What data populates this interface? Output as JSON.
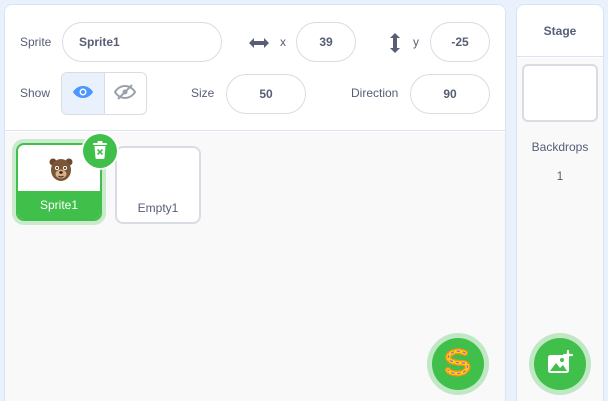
{
  "sprite_info": {
    "sprite_label": "Sprite",
    "sprite_name": "Sprite1",
    "x_label": "x",
    "x_value": "39",
    "y_label": "y",
    "y_value": "-25",
    "show_label": "Show",
    "show_visible": true,
    "size_label": "Size",
    "size_value": "50",
    "direction_label": "Direction",
    "direction_value": "90"
  },
  "sprites": [
    {
      "name": "Sprite1",
      "selected": true,
      "thumbnail": "bear-costume"
    },
    {
      "name": "Empty1",
      "selected": false,
      "thumbnail": "empty"
    }
  ],
  "stage": {
    "title": "Stage",
    "backdrops_label": "Backdrops",
    "backdrops_count": "1"
  },
  "icons": {
    "x_axis": "horizontal-arrows-icon",
    "y_axis": "vertical-arrows-icon",
    "show": "eye-icon",
    "hide": "eye-slash-icon",
    "delete": "trash-icon",
    "choose_sprite": "choose-sprite-icon",
    "choose_backdrop": "add-backdrop-icon"
  },
  "colors": {
    "accent_green": "#40bf4a",
    "eye_blue": "#4c97ff",
    "text": "#575e75",
    "pane_bg": "#e9f1fc"
  }
}
